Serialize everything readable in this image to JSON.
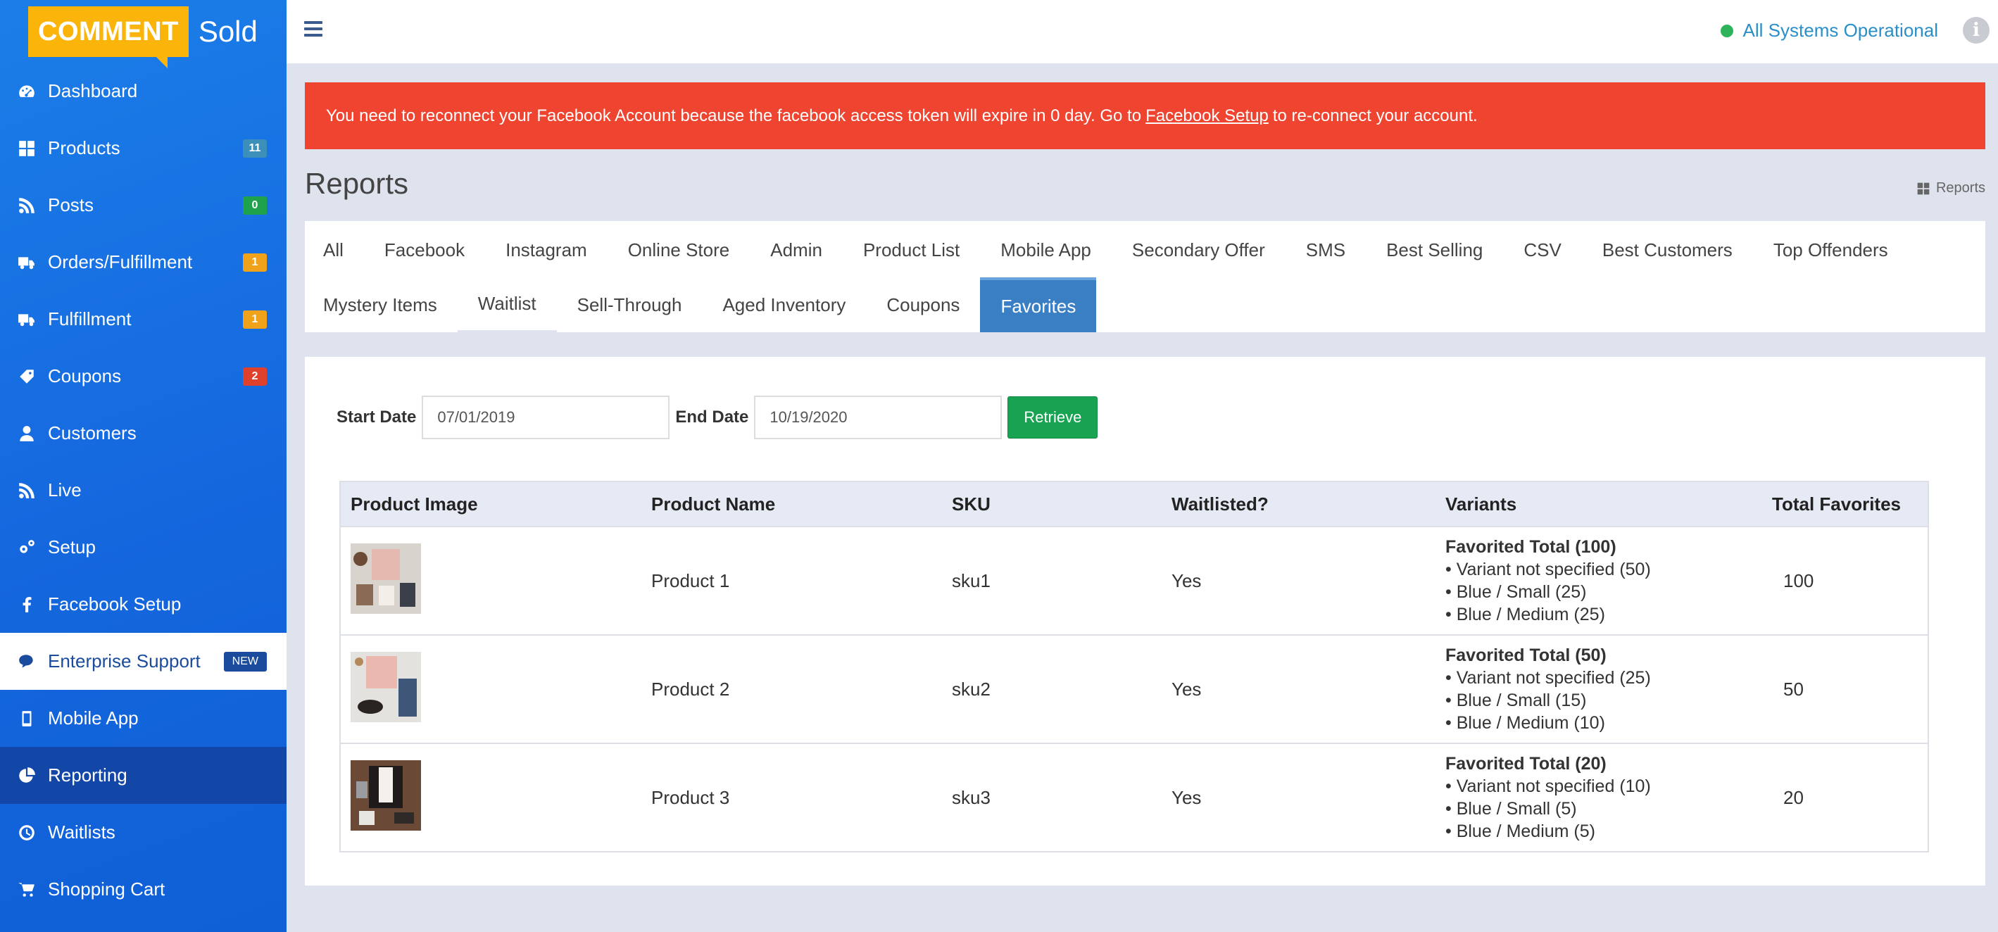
{
  "brand": {
    "logo_text": "COMMENT",
    "logo_word": "Sold"
  },
  "sidebar": {
    "items": [
      {
        "label": "Dashboard",
        "icon": "dashboard-icon"
      },
      {
        "label": "Products",
        "icon": "grid-icon",
        "badge": "11",
        "badge_color": "#3b8fb8"
      },
      {
        "label": "Posts",
        "icon": "rss-icon",
        "badge": "0",
        "badge_color": "#1ea34c"
      },
      {
        "label": "Orders/Fulfillment",
        "icon": "truck-icon",
        "badge": "1",
        "badge_color": "#f0a21a"
      },
      {
        "label": "Fulfillment",
        "icon": "truck-icon",
        "badge": "1",
        "badge_color": "#f0a21a"
      },
      {
        "label": "Coupons",
        "icon": "tag-icon",
        "badge": "2",
        "badge_color": "#e0412d"
      },
      {
        "label": "Customers",
        "icon": "user-icon"
      },
      {
        "label": "Live",
        "icon": "rss-icon"
      },
      {
        "label": "Setup",
        "icon": "gears-icon"
      },
      {
        "label": "Facebook Setup",
        "icon": "facebook-icon"
      },
      {
        "label": "Enterprise Support",
        "icon": "chat-icon",
        "badge": "NEW"
      },
      {
        "label": "Mobile App",
        "icon": "mobile-icon"
      },
      {
        "label": "Reporting",
        "icon": "pie-chart-icon"
      },
      {
        "label": "Waitlists",
        "icon": "clock-icon"
      },
      {
        "label": "Shopping Cart",
        "icon": "cart-icon"
      }
    ]
  },
  "header": {
    "status_text": "All Systems Operational",
    "info_icon": "i"
  },
  "alert": {
    "text_before": "You need to reconnect your Facebook Account because the facebook access token will expire in 0 day. Go to",
    "link": "Facebook Setup",
    "text_after": "to re-connect your account."
  },
  "page": {
    "title": "Reports",
    "breadcrumb": "Reports"
  },
  "tabs": {
    "row1": [
      "All",
      "Facebook",
      "Instagram",
      "Online Store",
      "Admin",
      "Product List",
      "Mobile App",
      "Secondary Offer",
      "SMS",
      "Best Selling",
      "CSV",
      "Best Customers",
      "Top Offenders"
    ],
    "row2": [
      "Mystery Items",
      "Waitlist",
      "Sell-Through",
      "Aged Inventory",
      "Coupons",
      "Favorites"
    ],
    "active": "Favorites"
  },
  "filter": {
    "start_label": "Start Date",
    "start_value": "07/01/2019",
    "end_label": "End Date",
    "end_value": "10/19/2020",
    "retrieve_label": "Retrieve"
  },
  "table": {
    "headers": [
      "Product Image",
      "Product Name",
      "SKU",
      "Waitlisted?",
      "Variants",
      "Total Favorites"
    ],
    "rows": [
      {
        "name": "Product 1",
        "sku": "sku1",
        "waitlisted": "Yes",
        "variant_total": "Favorited Total (100)",
        "variants": [
          "• Variant not specified (50)",
          "• Blue / Small (25)",
          "• Blue / Medium (25)"
        ],
        "total": "100"
      },
      {
        "name": "Product 2",
        "sku": "sku2",
        "waitlisted": "Yes",
        "variant_total": "Favorited Total (50)",
        "variants": [
          "• Variant not specified (25)",
          "• Blue / Small (15)",
          "• Blue / Medium (10)"
        ],
        "total": "50"
      },
      {
        "name": "Product 3",
        "sku": "sku3",
        "waitlisted": "Yes",
        "variant_total": "Favorited Total (20)",
        "variants": [
          "• Variant not specified (10)",
          "• Blue / Small (5)",
          "• Blue / Medium (5)"
        ],
        "total": "20"
      }
    ]
  }
}
